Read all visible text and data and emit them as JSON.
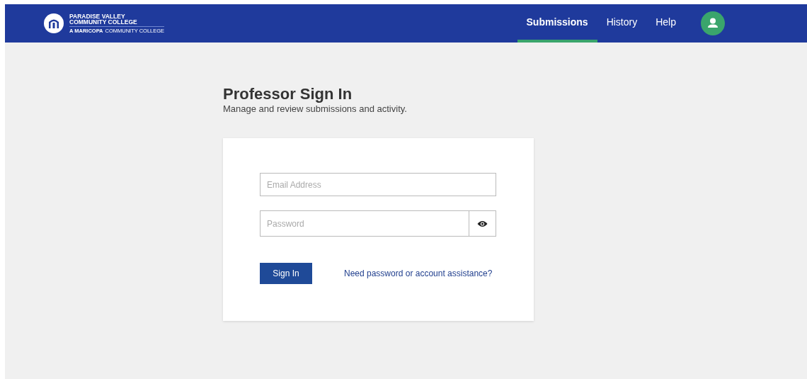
{
  "header": {
    "logo": {
      "line1": "PARADISE VALLEY",
      "line2": "COMMUNITY COLLEGE",
      "tagline_bold": "A MARICOPA",
      "tagline": "COMMUNITY COLLEGE"
    },
    "nav": [
      {
        "label": "Submissions",
        "selected": true
      },
      {
        "label": "History",
        "selected": false
      },
      {
        "label": "Help",
        "selected": false
      }
    ]
  },
  "title": "Professor Sign In",
  "subtitle": "Manage and review submissions and activity.",
  "form": {
    "email": {
      "placeholder": "Email Address"
    },
    "password": {
      "placeholder": "Password"
    },
    "submit": "Sign In",
    "help_link": "Need password or account assistance?"
  }
}
